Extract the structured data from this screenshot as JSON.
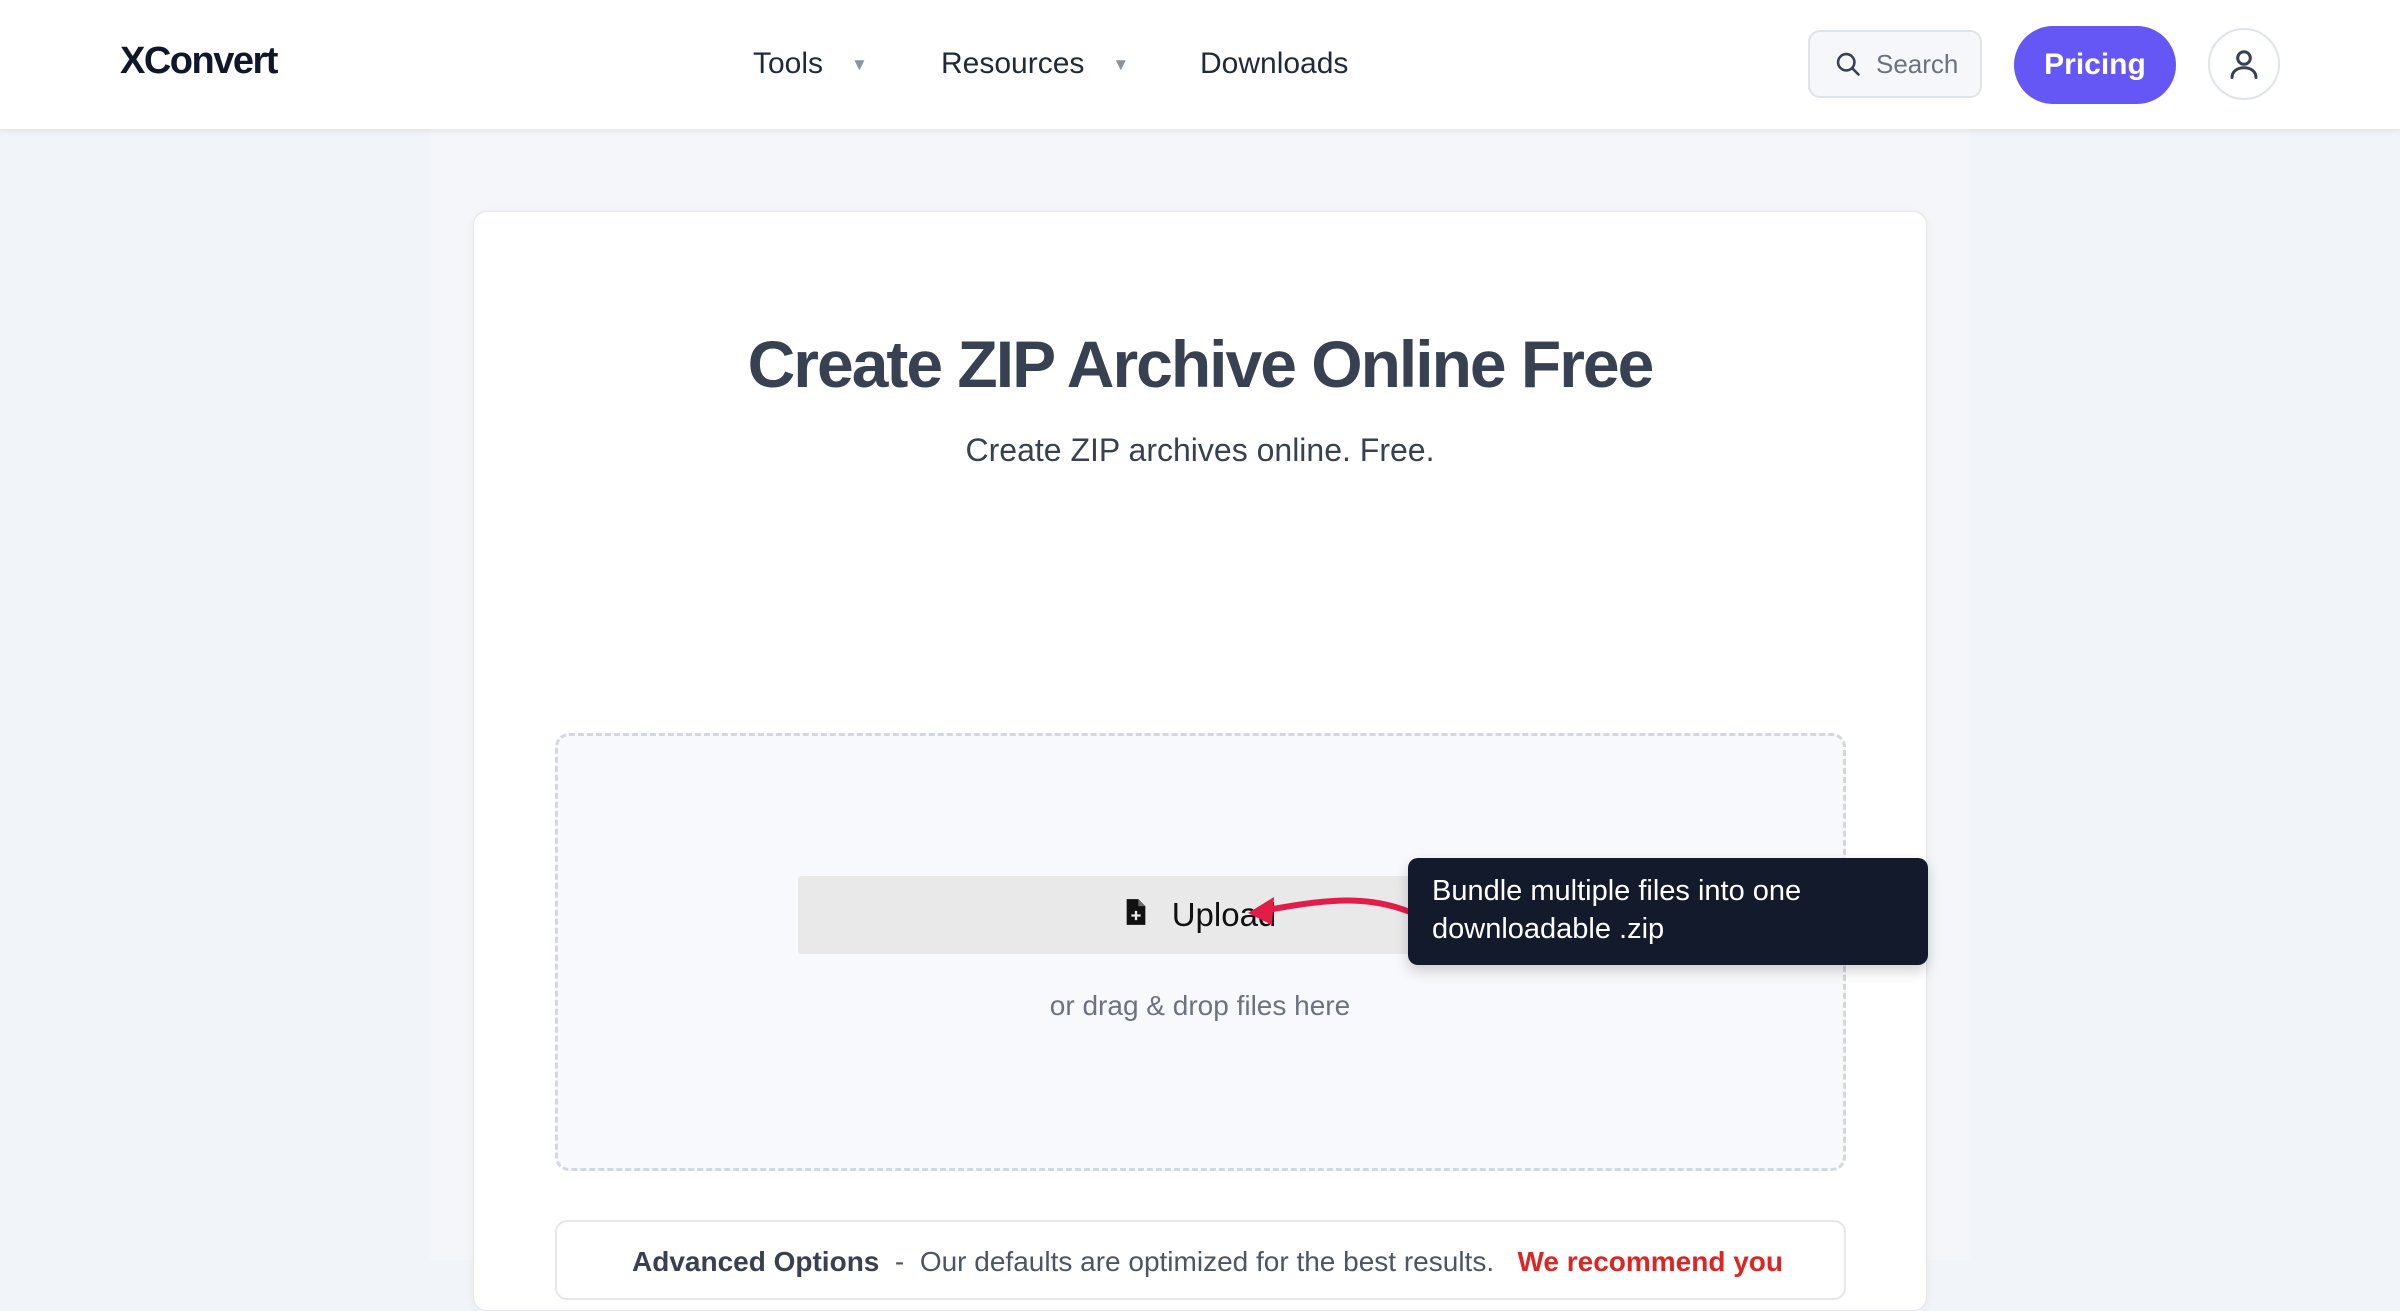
{
  "header": {
    "logo": "XConvert",
    "nav": {
      "tools": "Tools",
      "resources": "Resources",
      "downloads": "Downloads"
    },
    "search_label": "Search",
    "pricing_label": "Pricing"
  },
  "main": {
    "title": "Create ZIP Archive Online Free",
    "subtitle": "Create ZIP archives online. Free.",
    "upload_label": "Upload",
    "drag_text": "or drag & drop files here",
    "tooltip": "Bundle multiple files into one downloadable .zip"
  },
  "advanced": {
    "label": "Advanced Options",
    "text": "Our defaults are optimized for the best results.",
    "warning": "We recommend you"
  },
  "colors": {
    "accent": "#6457f6",
    "tooltip_bg": "#131a2b",
    "arrow": "#e11d48"
  }
}
